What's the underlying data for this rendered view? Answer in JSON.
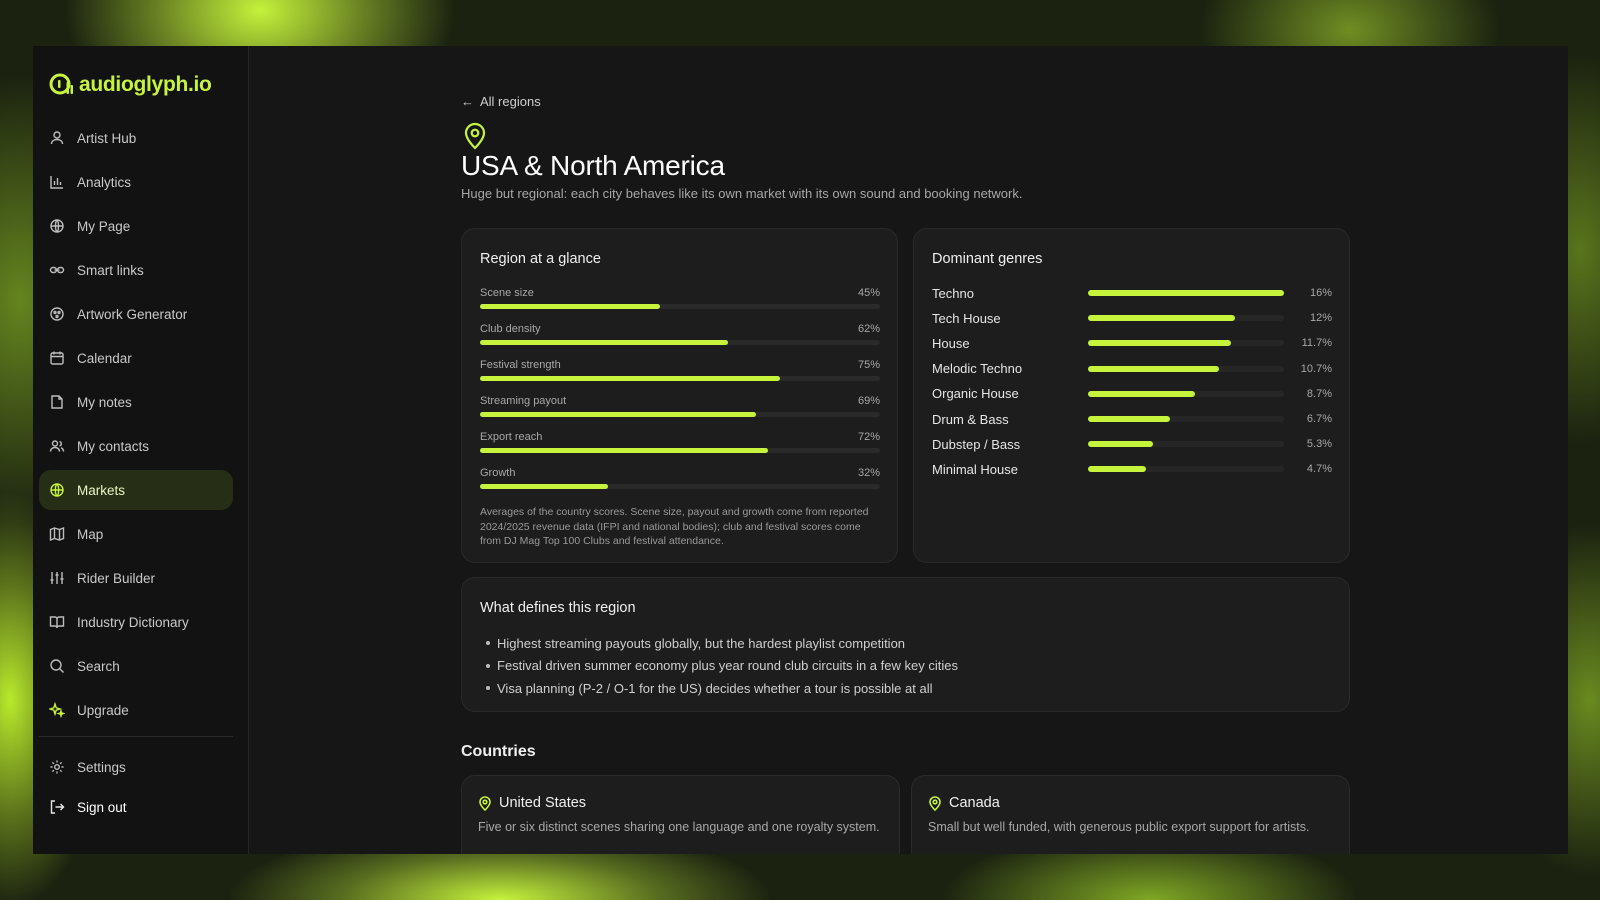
{
  "app": {
    "logo_text": "audioglyph.io"
  },
  "sidebar": {
    "items": [
      {
        "label": "Artist Hub",
        "icon": "user-icon"
      },
      {
        "label": "Analytics",
        "icon": "bar-chart-icon"
      },
      {
        "label": "My Page",
        "icon": "globe-grid-icon"
      },
      {
        "label": "Smart links",
        "icon": "link-icon"
      },
      {
        "label": "Artwork Generator",
        "icon": "palette-icon"
      },
      {
        "label": "Calendar",
        "icon": "calendar-icon"
      },
      {
        "label": "My notes",
        "icon": "note-icon"
      },
      {
        "label": "My contacts",
        "icon": "users-icon"
      },
      {
        "label": "Markets",
        "icon": "globe-icon",
        "active": true
      },
      {
        "label": "Map",
        "icon": "map-icon"
      },
      {
        "label": "Rider Builder",
        "icon": "sliders-icon"
      },
      {
        "label": "Industry Dictionary",
        "icon": "book-icon"
      },
      {
        "label": "Search",
        "icon": "search-icon"
      },
      {
        "label": "Upgrade",
        "icon": "sparkle-icon"
      }
    ],
    "bottom": [
      {
        "label": "Settings",
        "icon": "gear-icon"
      },
      {
        "label": "Sign out",
        "icon": "sign-out-icon"
      }
    ]
  },
  "header": {
    "back_label": "All regions",
    "title": "USA & North America",
    "subtitle": "Huge but regional: each city behaves like its own market with its own sound and booking network."
  },
  "glance": {
    "title": "Region at a glance",
    "metrics": [
      {
        "label": "Scene size",
        "value": "45%",
        "fraction": 0.45
      },
      {
        "label": "Club density",
        "value": "62%",
        "fraction": 0.62
      },
      {
        "label": "Festival strength",
        "value": "75%",
        "fraction": 0.75
      },
      {
        "label": "Streaming payout",
        "value": "69%",
        "fraction": 0.69
      },
      {
        "label": "Export reach",
        "value": "72%",
        "fraction": 0.72
      },
      {
        "label": "Growth",
        "value": "32%",
        "fraction": 0.32
      }
    ],
    "note": "Averages of the country scores. Scene size, payout and growth come from reported 2024/2025 revenue data (IFPI and national bodies); club and festival scores come from DJ Mag Top 100 Clubs and festival attendance."
  },
  "genres": {
    "title": "Dominant genres",
    "max_share": 16,
    "items": [
      {
        "name": "Techno",
        "value": "16%",
        "share": 16
      },
      {
        "name": "Tech House",
        "value": "12%",
        "share": 12
      },
      {
        "name": "House",
        "value": "11.7%",
        "share": 11.7
      },
      {
        "name": "Melodic Techno",
        "value": "10.7%",
        "share": 10.7
      },
      {
        "name": "Organic House",
        "value": "8.7%",
        "share": 8.7
      },
      {
        "name": "Drum & Bass",
        "value": "6.7%",
        "share": 6.7
      },
      {
        "name": "Dubstep / Bass",
        "value": "5.3%",
        "share": 5.3
      },
      {
        "name": "Minimal House",
        "value": "4.7%",
        "share": 4.7
      }
    ]
  },
  "defines": {
    "title": "What defines this region",
    "bullets": [
      "Highest streaming payouts globally, but the hardest playlist competition",
      "Festival driven summer economy plus year round club circuits in a few key cities",
      "Visa planning (P-2 / O-1 for the US) decides whether a tour is possible at all"
    ]
  },
  "countries": {
    "heading": "Countries",
    "items": [
      {
        "name": "United States",
        "desc": "Five or six distinct scenes sharing one language and one royalty system."
      },
      {
        "name": "Canada",
        "desc": "Small but well funded, with generous public export support for artists."
      }
    ]
  },
  "colors": {
    "accent": "#c6f43c",
    "background": "#161616",
    "card": "#1d1d1d"
  }
}
